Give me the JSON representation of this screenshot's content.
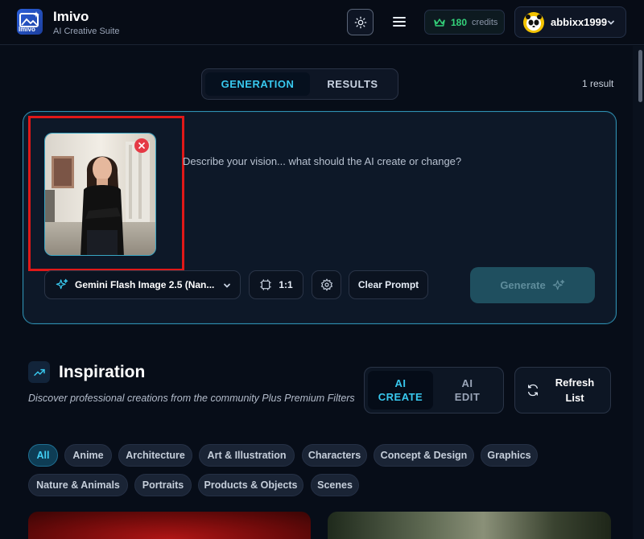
{
  "header": {
    "brand_title": "Imivo",
    "brand_subtitle": "AI Creative Suite",
    "logo_text": "Imivo",
    "credits_count": "180",
    "credits_label": "credits",
    "username": "abbixx1999",
    "accent_color": "#38c8ee",
    "credits_color": "#34d27a"
  },
  "tabs": [
    {
      "label": "GENERATION",
      "active": true
    },
    {
      "label": "RESULTS",
      "active": false
    }
  ],
  "result_count": "1 result",
  "prompt": {
    "placeholder": "Describe your vision... what should the AI create or change?",
    "value": "",
    "model_label": "Gemini Flash Image 2.5 (Nan...",
    "ratio_label": "1:1",
    "clear_label": "Clear Prompt",
    "generate_label": "Generate"
  },
  "inspiration": {
    "title": "Inspiration",
    "description": "Discover professional creations from the community Plus Premium Filters",
    "mode_create_line1": "AI",
    "mode_create_line2": "CREATE",
    "mode_edit_line1": "AI",
    "mode_edit_line2": "EDIT",
    "refresh_line1": "Refresh",
    "refresh_line2": "List"
  },
  "categories": [
    "All",
    "Anime",
    "Architecture",
    "Art & Illustration",
    "Characters",
    "Concept & Design",
    "Graphics",
    "Nature & Animals",
    "Portraits",
    "Products & Objects",
    "Scenes"
  ],
  "active_category": "All"
}
